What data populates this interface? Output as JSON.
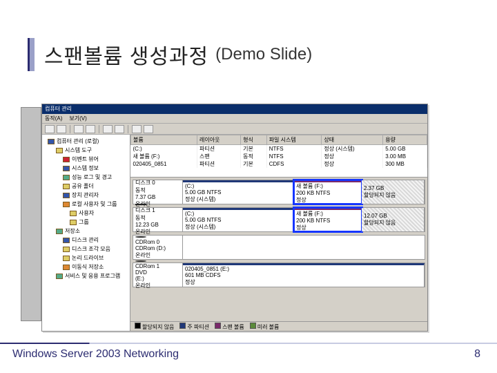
{
  "slide": {
    "title": "스팬볼륨 생성과정",
    "subtitle": "(Demo Slide)",
    "footer": "Windows Server 2003 Networking",
    "page": "8"
  },
  "app": {
    "title": "컴퓨터 관리",
    "menus": [
      "동작(A)",
      "보기(V)"
    ],
    "close": "×",
    "tree": [
      {
        "lv": 0,
        "ic": "blue",
        "t": "컴퓨터 관리 (로컬)"
      },
      {
        "lv": 1,
        "ic": "yel",
        "t": "시스템 도구"
      },
      {
        "lv": 2,
        "ic": "red",
        "t": "이벤트 뷰어"
      },
      {
        "lv": 2,
        "ic": "blue",
        "t": "시스템 정보"
      },
      {
        "lv": 2,
        "ic": "grn",
        "t": "성능 로그 및 경고"
      },
      {
        "lv": 2,
        "ic": "yel",
        "t": "공유 폴더"
      },
      {
        "lv": 2,
        "ic": "blue",
        "t": "장치 관리자"
      },
      {
        "lv": 2,
        "ic": "org",
        "t": "로컬 사용자 및 그룹"
      },
      {
        "lv": 3,
        "ic": "yel",
        "t": "사용자"
      },
      {
        "lv": 3,
        "ic": "yel",
        "t": "그룹"
      },
      {
        "lv": 1,
        "ic": "grn",
        "t": "저장소"
      },
      {
        "lv": 2,
        "ic": "blue",
        "t": "디스크 관리"
      },
      {
        "lv": 2,
        "ic": "yel",
        "t": "디스크 조각 모음"
      },
      {
        "lv": 2,
        "ic": "yel",
        "t": "논리 드라이브"
      },
      {
        "lv": 2,
        "ic": "org",
        "t": "이동식 저장소"
      },
      {
        "lv": 1,
        "ic": "grn",
        "t": "서비스 및 응용 프로그램"
      }
    ],
    "volcols": [
      "볼륨",
      "레이아웃",
      "형식",
      "파일 시스템",
      "상태",
      "용량"
    ],
    "volumes": [
      {
        "n": "(C:)",
        "l": "파티션",
        "t": "기본",
        "fs": "NTFS",
        "s": "정상 (시스템)",
        "c": "5.00 GB"
      },
      {
        "n": "새 볼륨 (F:)",
        "l": "스팬",
        "t": "동적",
        "fs": "NTFS",
        "s": "정상",
        "c": "3.00 MB"
      },
      {
        "n": "020405_0851",
        "l": "파티션",
        "t": "기본",
        "fs": "CDFS",
        "s": "정상",
        "c": "300 MB"
      }
    ],
    "disks": [
      {
        "label": {
          "name": "디스크 0",
          "kind": "동적",
          "size": "7.37 GB",
          "state": "온라인"
        },
        "parts": [
          {
            "cls": "sys",
            "a": "(C:)",
            "b": "5.00 GB NTFS",
            "c": "정상 (시스템)"
          },
          {
            "cls": "new hl-blue",
            "a": "새 볼륨  (F:)",
            "b": "200 KB NTFS",
            "c": "정상"
          },
          {
            "cls": "free",
            "a": "",
            "b": "2.37 GB",
            "c": "할당되지 않음"
          }
        ]
      },
      {
        "label": {
          "name": "디스크 1",
          "kind": "동적",
          "size": "12.23 GB",
          "state": "온라인"
        },
        "parts": [
          {
            "cls": "sys",
            "a": "(C:)",
            "b": "5.00 GB NTFS",
            "c": "정상 (시스템)"
          },
          {
            "cls": "new hl-blue",
            "a": "새 볼륨  (F:)",
            "b": "200 KB NTFS",
            "c": "정상"
          },
          {
            "cls": "free",
            "a": "",
            "b": "12.07 GB",
            "c": "할당되지 않음"
          }
        ]
      },
      {
        "cd": true,
        "label": {
          "name": "CDRom 0",
          "kind": "CDRom (D:)",
          "size": "",
          "state": "온라인"
        },
        "parts": []
      },
      {
        "cd": true,
        "label": {
          "name": "CDRom 1",
          "kind": "DVD",
          "size": "(E:)",
          "state": "온라인"
        },
        "parts": [
          {
            "cls": "sys long",
            "a": "020405_0851  (E:)",
            "b": "601 MB CDFS",
            "c": "정상"
          }
        ]
      }
    ],
    "legend": [
      {
        "c": "na",
        "t": "할당되지 않음"
      },
      {
        "c": "pr",
        "t": "주 파티션"
      },
      {
        "c": "sp",
        "t": "스팬 볼륨"
      },
      {
        "c": "ot",
        "t": "미러 볼륨"
      }
    ]
  }
}
